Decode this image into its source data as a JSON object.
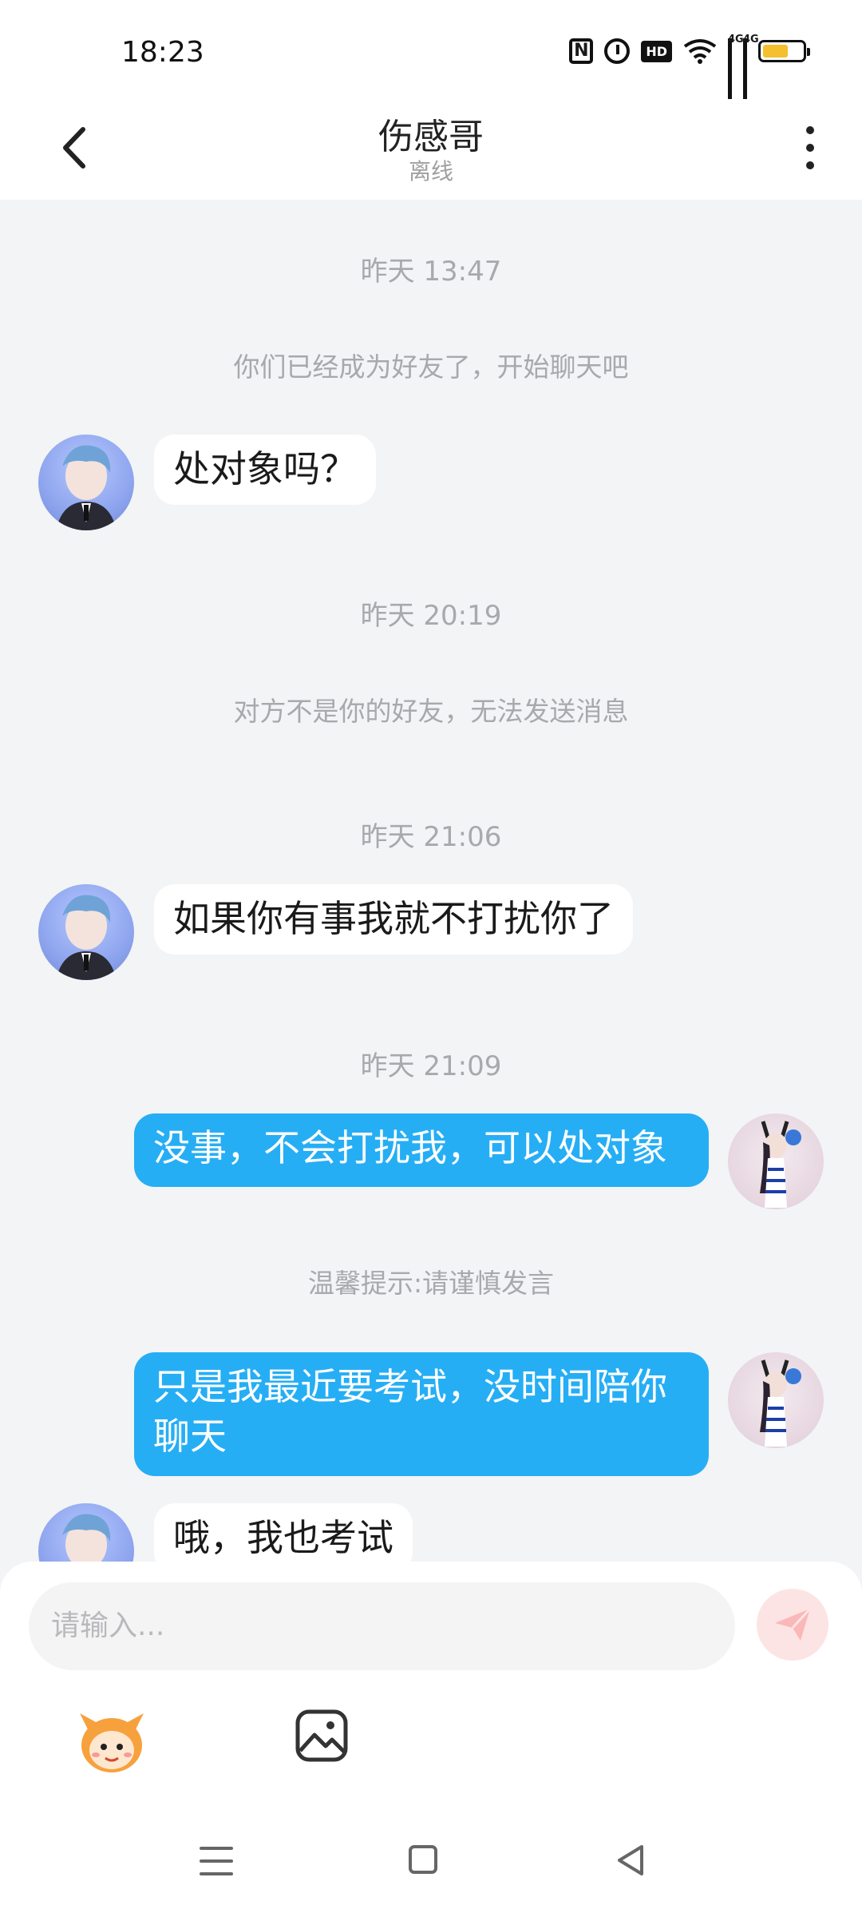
{
  "status_bar": {
    "time": "18:23",
    "icons": [
      "nfc-icon",
      "alarm-icon",
      "hd-voice-icon",
      "wifi-icon",
      "signal-4g-icon",
      "signal-4g-icon",
      "battery-icon"
    ],
    "hd_label": "HD",
    "signal_label": "4G",
    "battery_level": 0.65
  },
  "header": {
    "title": "伤感哥",
    "subtitle": "离线"
  },
  "messages": [
    {
      "type": "time",
      "text": "昨天 13:47"
    },
    {
      "type": "system",
      "text": "你们已经成为好友了，开始聊天吧"
    },
    {
      "type": "incoming",
      "text": "处对象吗？"
    },
    {
      "type": "time",
      "text": "昨天 20:19"
    },
    {
      "type": "system",
      "text": "对方不是你的好友，无法发送消息"
    },
    {
      "type": "time",
      "text": "昨天 21:06"
    },
    {
      "type": "incoming",
      "text": "如果你有事我就不打扰你了"
    },
    {
      "type": "time",
      "text": "昨天 21:09"
    },
    {
      "type": "outgoing",
      "text": "没事，不会打扰我，可以处对象"
    },
    {
      "type": "system",
      "text": "温馨提示:请谨慎发言"
    },
    {
      "type": "outgoing",
      "text": "只是我最近要考试，没时间陪你聊天"
    },
    {
      "type": "incoming",
      "text": "哦，我也考试"
    }
  ],
  "composer": {
    "placeholder": "请输入..."
  },
  "colors": {
    "outgoing_bubble": "#26aef5",
    "incoming_bubble": "#ffffff",
    "chat_background": "#f3f4f6",
    "send_button": "#fde4e4"
  }
}
